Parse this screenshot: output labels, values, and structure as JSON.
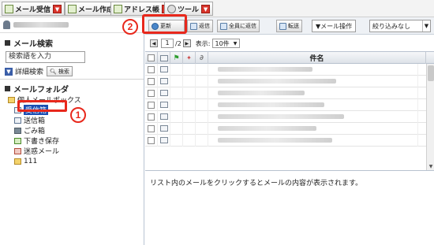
{
  "top_tabs": [
    {
      "label": "メール受信",
      "icon": "mail-receive-icon"
    },
    {
      "label": "メール作成",
      "icon": "mail-compose-icon"
    },
    {
      "label": "アドレス帳",
      "icon": "address-book-icon"
    },
    {
      "label": "ツール",
      "icon": "tools-icon"
    }
  ],
  "sidebar": {
    "mail_search_title": "メール検索",
    "search_placeholder": "検索語を入力",
    "advanced_search_label": "詳細検索",
    "search_button_label": "検索",
    "mail_folder_title": "メールフォルダ",
    "root_folder": "個人メールボックス",
    "folders": [
      {
        "label": "受信箱",
        "icon": "inbox-icon",
        "selected": true
      },
      {
        "label": "送信箱",
        "icon": "sent-icon",
        "selected": false
      },
      {
        "label": "ごみ箱",
        "icon": "trash-icon",
        "selected": false
      },
      {
        "label": "下書き保存",
        "icon": "draft-icon",
        "selected": false
      },
      {
        "label": "迷惑メール",
        "icon": "spam-icon",
        "selected": false
      },
      {
        "label": "111",
        "icon": "folder-icon",
        "selected": false
      }
    ]
  },
  "toolbar": {
    "refresh_label": "更新",
    "reply_label": "返信",
    "reply_all_label": "全員に返信",
    "forward_label": "転送",
    "mail_operation_label": "▼メール操作",
    "filter_label": "絞り込みなし"
  },
  "pager": {
    "current_page": "1",
    "total_pages": "/2",
    "display_label": "表示:",
    "per_page": "10件"
  },
  "table": {
    "subject_header": "件名",
    "row_count": 7
  },
  "preview_text": "リスト内のメールをクリックするとメールの内容が表示されます。",
  "annotations": {
    "callout_1": "1",
    "callout_2": "2",
    "highlight_color": "#e8281c"
  },
  "colors": {
    "selected_folder_bg": "#1b4fb3",
    "accent_blue": "#3a5ea8"
  }
}
